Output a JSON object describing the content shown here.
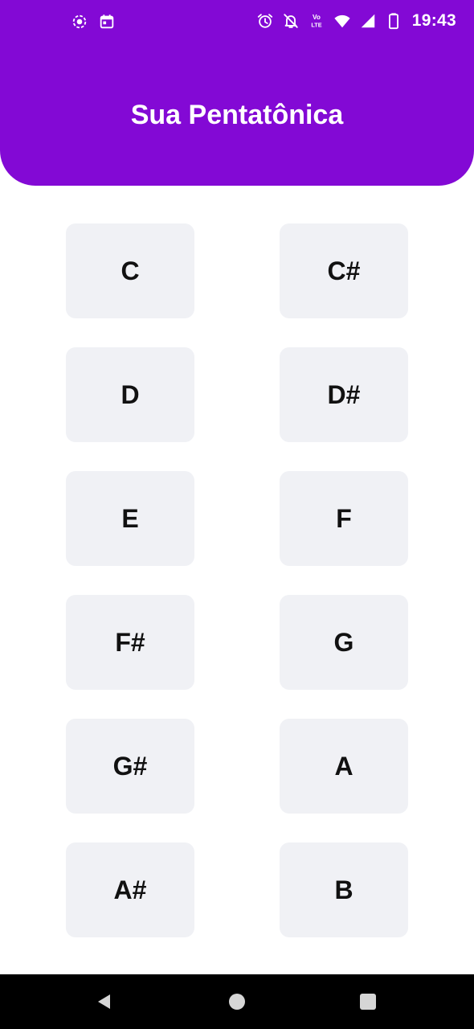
{
  "status_bar": {
    "time": "19:43",
    "left_icons": [
      "screen-record-icon",
      "calendar-icon"
    ],
    "right_icons": [
      "alarm-icon",
      "notifications-off-icon",
      "volte-icon",
      "wifi-icon",
      "signal-icon",
      "battery-icon"
    ],
    "volte_top": "Vo",
    "volte_bottom": "LTE"
  },
  "header": {
    "title": "Sua Pentatônica",
    "background": "#8309d5"
  },
  "notes": [
    {
      "label": "C"
    },
    {
      "label": "C#"
    },
    {
      "label": "D"
    },
    {
      "label": "D#"
    },
    {
      "label": "E"
    },
    {
      "label": "F"
    },
    {
      "label": "F#"
    },
    {
      "label": "G"
    },
    {
      "label": "G#"
    },
    {
      "label": "A"
    },
    {
      "label": "A#"
    },
    {
      "label": "B"
    }
  ],
  "nav_bar": {
    "buttons": [
      "back-icon",
      "home-icon",
      "recents-icon"
    ]
  }
}
